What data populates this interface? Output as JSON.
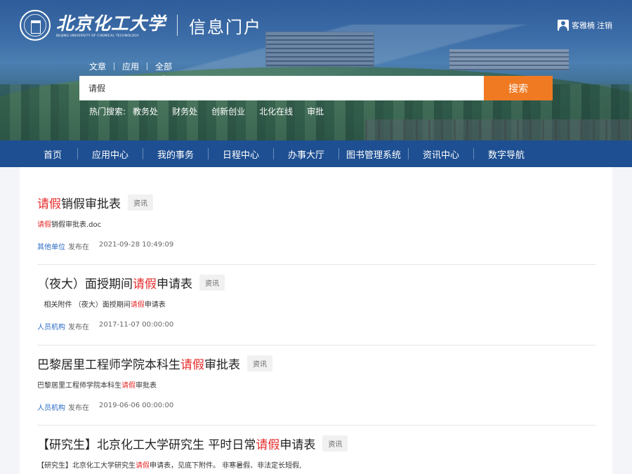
{
  "header": {
    "logo_cn": "北京化工大学",
    "logo_en": "BEIJING UNIVERSITY OF CHEMICAL TECHNOLOGY",
    "portal_title": "信息门户",
    "user_name": "客雅楠",
    "logout_label": "注销"
  },
  "search": {
    "tabs": [
      "文章",
      "应用",
      "全部"
    ],
    "active_tab": "全部",
    "query": "请假",
    "button_label": "搜索",
    "hot_label": "热门搜索:",
    "hot_keywords": [
      "教务处",
      "财务处",
      "创新创业",
      "北化在线",
      "审批"
    ]
  },
  "nav": {
    "items": [
      "首页",
      "应用中心",
      "我的事务",
      "日程中心",
      "办事大厅",
      "图书管理系统",
      "资讯中心",
      "数字导航"
    ]
  },
  "results": [
    {
      "title_pre": "",
      "title_hl": "请假",
      "title_post": "销假审批表",
      "badge": "资讯",
      "desc_pre": "",
      "desc_hl": "请假",
      "desc_post": "销假审批表.doc",
      "source": "其他单位",
      "published": "发布在",
      "date": "2021-09-28 10:49:09"
    },
    {
      "title_pre": "（夜大）面授期间",
      "title_hl": "请假",
      "title_post": "申请表",
      "badge": "资讯",
      "desc_pre": "   相关附件 （夜大）面授期间",
      "desc_hl": "请假",
      "desc_post": "申请表",
      "source": "人员机构",
      "published": "发布在",
      "date": "2017-11-07 00:00:00"
    },
    {
      "title_pre": "巴黎居里工程师学院本科生",
      "title_hl": "请假",
      "title_post": "审批表",
      "badge": "资讯",
      "desc_pre": "巴黎居里工程师学院本科生",
      "desc_hl": "请假",
      "desc_post": "审批表",
      "source": "人员机构",
      "published": "发布在",
      "date": "2019-06-06 00:00:00"
    },
    {
      "title_pre": "【研究生】北京化工大学研究生 平时日常",
      "title_hl": "请假",
      "title_post": "申请表",
      "badge": "资讯",
      "desc_pre": "【研究生】北京化工大学研究生",
      "desc_hl": "请假",
      "desc_post": "申请表，见底下附件。 非寒暑假、非法定长短假,",
      "source": "",
      "published": "",
      "date": ""
    }
  ],
  "colors": {
    "nav_bg": "#1e4f92",
    "search_button": "#ef7a22",
    "highlight": "#e62b2b",
    "source_link": "#2a6cc4"
  }
}
